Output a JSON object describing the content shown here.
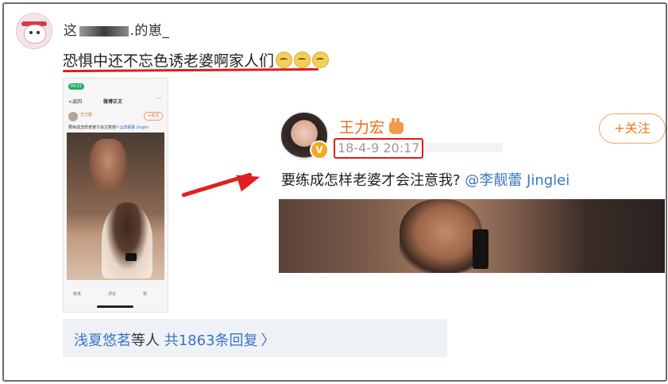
{
  "post": {
    "username_prefix": "这",
    "username_suffix": ".的崽_",
    "text": "恐惧中还不忘色诱老婆啊家人们",
    "emoji_count": 3
  },
  "phone_screenshot": {
    "status": "09:21",
    "back_label": "<返回",
    "nav_title": "微博正文",
    "more": "···",
    "name": "王力宏",
    "follow": "+关注",
    "text": "要练成怎样老婆才会注意我?",
    "mention": "@李靓蕾 Jinglei",
    "action_repost": "转发",
    "action_comment": "评论",
    "action_like": "赞"
  },
  "zoom": {
    "name": "王力宏",
    "time": "18-4-9 20:17",
    "follow": "+关注",
    "text": "要练成怎样老婆才会注意我?",
    "mention": "@李靓蕾 Jinglei",
    "badge": "V"
  },
  "reply": {
    "names": "浅夏悠茗",
    "middle": "等人",
    "count_text": "共1863条回复",
    "chevron": "〉"
  },
  "colors": {
    "accent_orange": "#ef6a16",
    "link_blue": "#3a74c4",
    "highlight_red": "#e21b1b"
  }
}
